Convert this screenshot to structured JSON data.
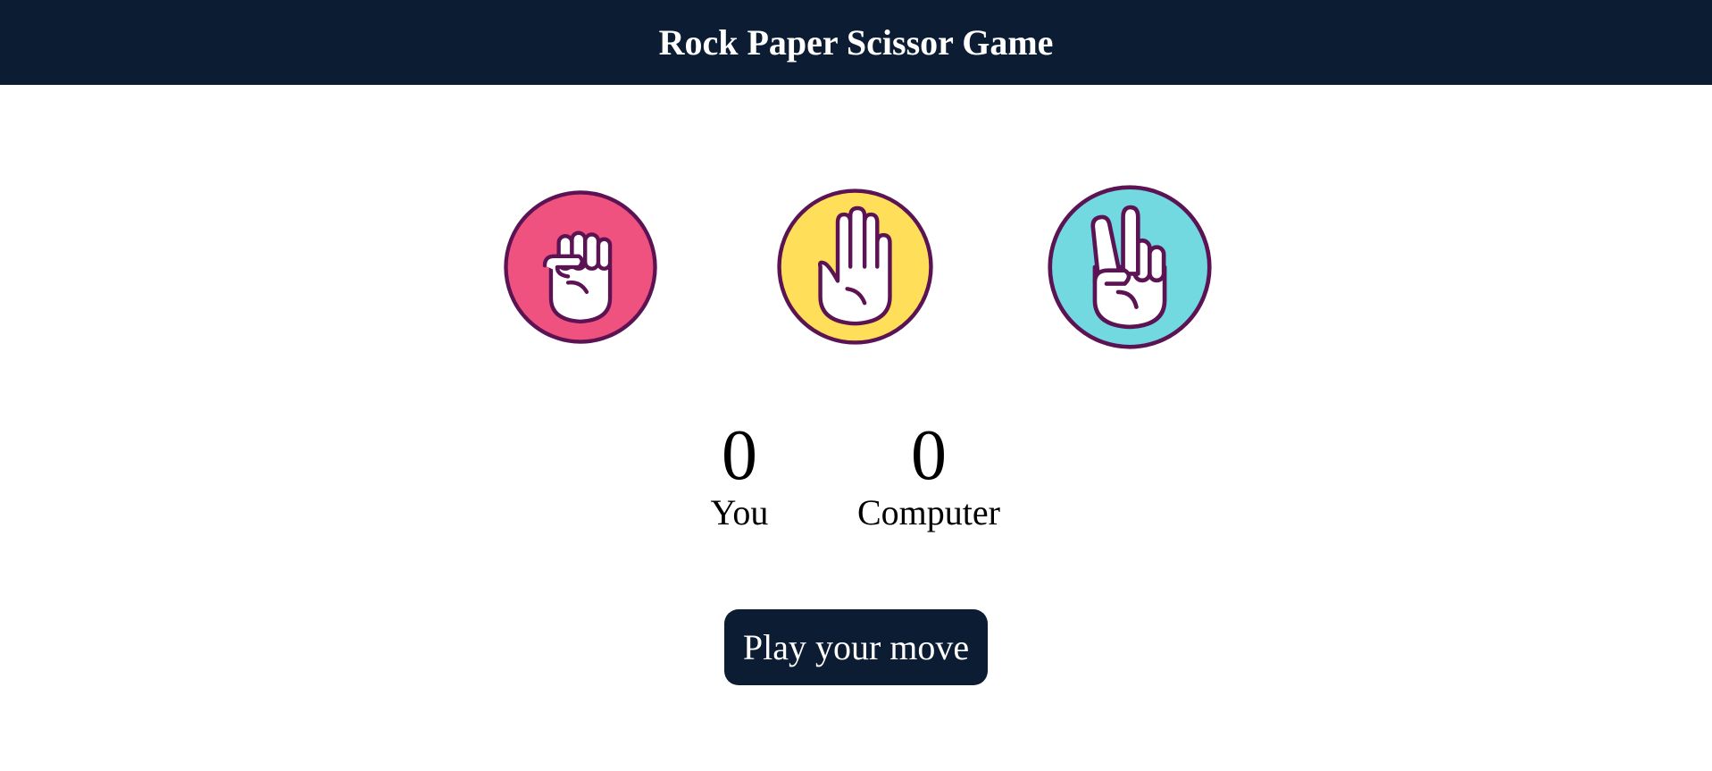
{
  "header": {
    "title": "Rock Paper Scissor Game"
  },
  "choices": [
    {
      "name": "rock",
      "icon": "fist-icon",
      "color": "#f0527f"
    },
    {
      "name": "paper",
      "icon": "open-hand-icon",
      "color": "#ffdf5a"
    },
    {
      "name": "scissors",
      "icon": "peace-hand-icon",
      "color": "#72d9e0"
    }
  ],
  "outline_color": "#5c1354",
  "scoreboard": {
    "user_score": "0",
    "user_label": "You",
    "computer_score": "0",
    "computer_label": "Computer"
  },
  "message": {
    "text": "Play your move"
  },
  "colors": {
    "navbar": "#0b1c33",
    "button": "#0b1c33"
  }
}
